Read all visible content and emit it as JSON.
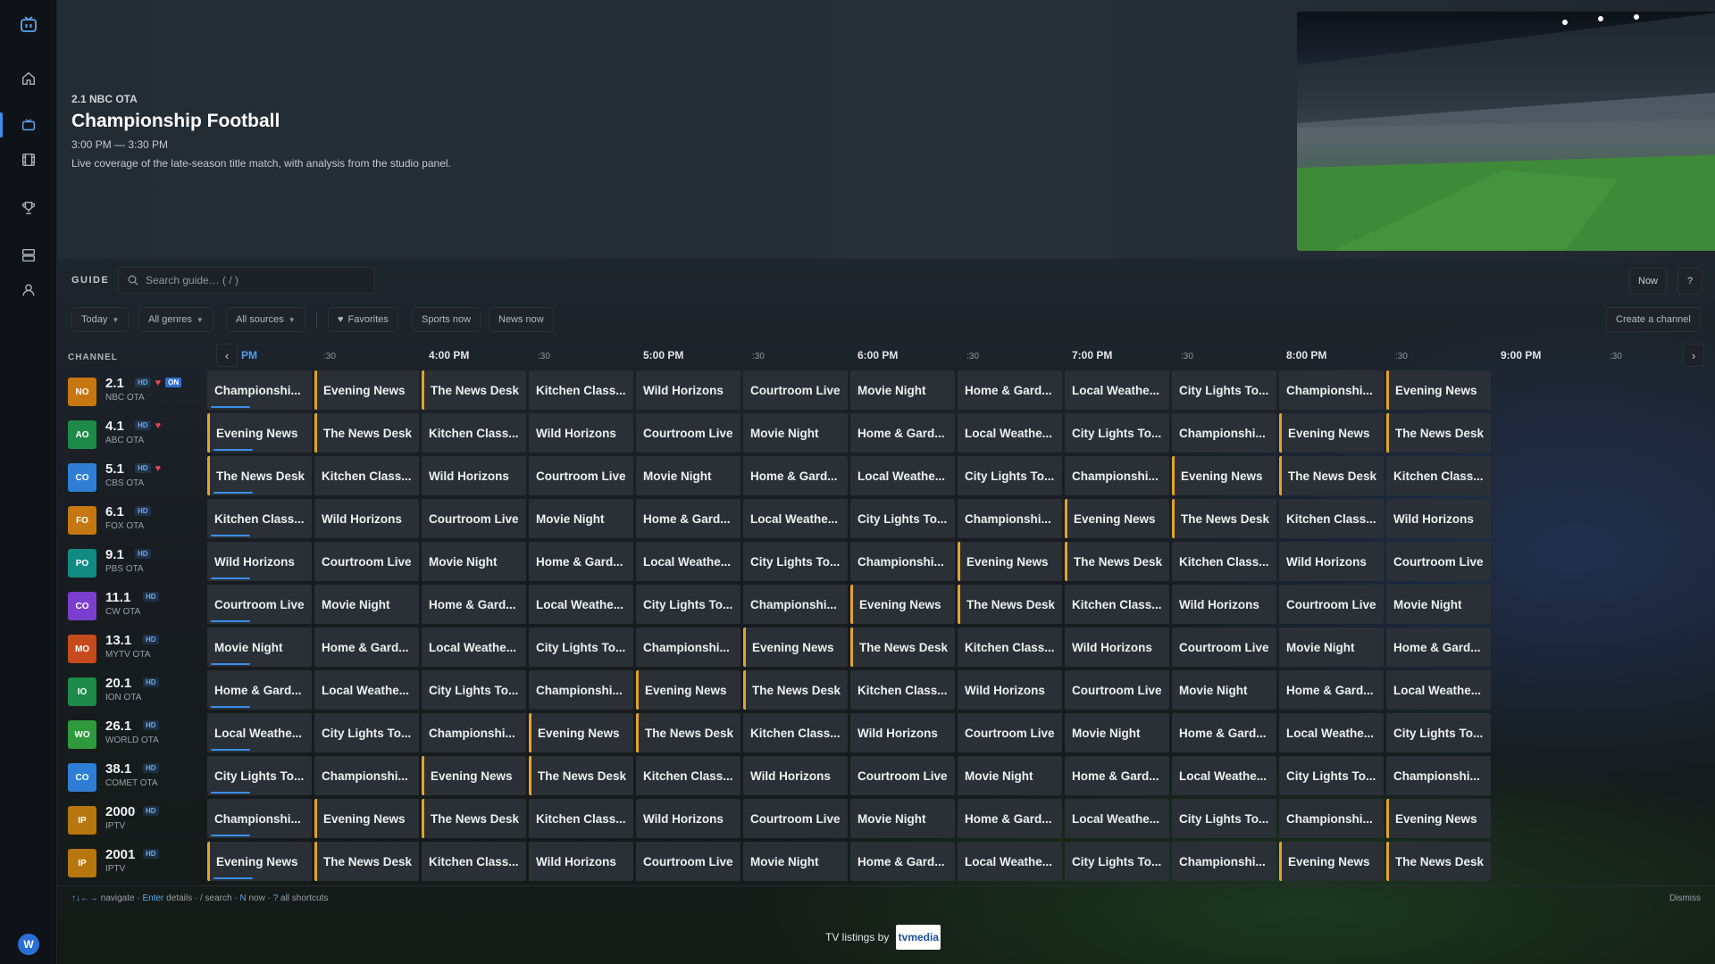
{
  "sidebar": {
    "items": [
      {
        "name": "home",
        "icon": "home-icon",
        "active": false
      },
      {
        "name": "live-tv",
        "icon": "tv-icon",
        "active": true
      },
      {
        "name": "movies",
        "icon": "film-icon",
        "active": false
      },
      {
        "name": "sports",
        "icon": "trophy-icon",
        "active": false
      },
      {
        "name": "library",
        "icon": "storage-icon",
        "active": false
      },
      {
        "name": "profile",
        "icon": "user-icon",
        "active": false
      }
    ],
    "avatar_letter": "W"
  },
  "hero": {
    "channel": "2.1 NBC OTA",
    "title": "Championship Football",
    "time": "3:00 PM — 3:30 PM",
    "description": "Live coverage of the late-season title match, with analysis from the studio panel."
  },
  "guide": {
    "label": "GUIDE",
    "search_placeholder": "Search guide… ( / )",
    "now_button": "Now",
    "help_button": "?"
  },
  "filters": {
    "today": "Today",
    "genres": "All genres",
    "sources": "All sources",
    "favorites": "Favorites",
    "sports_now": "Sports now",
    "news_now": "News now",
    "create_channel": "Create a channel"
  },
  "timeline": {
    "channel_header": "CHANNEL",
    "labels": [
      "PM",
      ":30",
      "4:00 PM",
      ":30",
      "5:00 PM",
      ":30",
      "6:00 PM",
      ":30",
      "7:00 PM",
      ":30",
      "8:00 PM",
      ":30",
      "9:00 PM",
      ":30"
    ]
  },
  "channels": [
    {
      "abbr": "NO",
      "num": "2.1",
      "src": "NBC OTA",
      "color": "#c77712",
      "hd": true,
      "fav": true,
      "on": true
    },
    {
      "abbr": "AO",
      "num": "4.1",
      "src": "ABC OTA",
      "color": "#1e8a4a",
      "hd": true,
      "fav": true,
      "on": false
    },
    {
      "abbr": "CO",
      "num": "5.1",
      "src": "CBS OTA",
      "color": "#2f7ed6",
      "hd": true,
      "fav": true,
      "on": false
    },
    {
      "abbr": "FO",
      "num": "6.1",
      "src": "FOX OTA",
      "color": "#c77712",
      "hd": true,
      "fav": false,
      "on": false
    },
    {
      "abbr": "PO",
      "num": "9.1",
      "src": "PBS OTA",
      "color": "#118a82",
      "hd": true,
      "fav": false,
      "on": false
    },
    {
      "abbr": "CO",
      "num": "11.1",
      "src": "CW OTA",
      "color": "#7a3fcf",
      "hd": true,
      "fav": false,
      "on": false
    },
    {
      "abbr": "MO",
      "num": "13.1",
      "src": "MYTV OTA",
      "color": "#c64a1c",
      "hd": true,
      "fav": false,
      "on": false
    },
    {
      "abbr": "IO",
      "num": "20.1",
      "src": "ION OTA",
      "color": "#1e8a4a",
      "hd": true,
      "fav": false,
      "on": false
    },
    {
      "abbr": "WO",
      "num": "26.1",
      "src": "WORLD OTA",
      "color": "#2e9a3c",
      "hd": true,
      "fav": false,
      "on": false
    },
    {
      "abbr": "CO",
      "num": "38.1",
      "src": "COMET OTA",
      "color": "#2f7ed6",
      "hd": true,
      "fav": false,
      "on": false
    },
    {
      "abbr": "IP",
      "num": "2000",
      "src": "IPTV",
      "color": "#b8760f",
      "hd": true,
      "fav": false,
      "on": false
    },
    {
      "abbr": "IP",
      "num": "2001",
      "src": "IPTV",
      "color": "#b8760f",
      "hd": true,
      "fav": false,
      "on": false
    }
  ],
  "programs": {
    "titles": [
      "Championshi...",
      "Evening News",
      "The News Desk",
      "Kitchen Class...",
      "Wild Horizons",
      "Courtroom Live",
      "Movie Night",
      "Home & Gard...",
      "Local Weathe...",
      "City Lights To..."
    ],
    "cols_per_row": 12
  },
  "hints": {
    "text_parts": [
      "↑↓←→",
      " navigate · ",
      "Enter",
      " details · ",
      "/",
      " search · ",
      "N",
      " now · ",
      "?",
      " all shortcuts"
    ],
    "dismiss": "Dismiss"
  },
  "attribution": {
    "text": "TV listings by",
    "logo": "tvmedia"
  },
  "colors": {
    "accent": "#3b8eea",
    "event_marker": "#e3a32a",
    "favorite": "#e0455b"
  }
}
